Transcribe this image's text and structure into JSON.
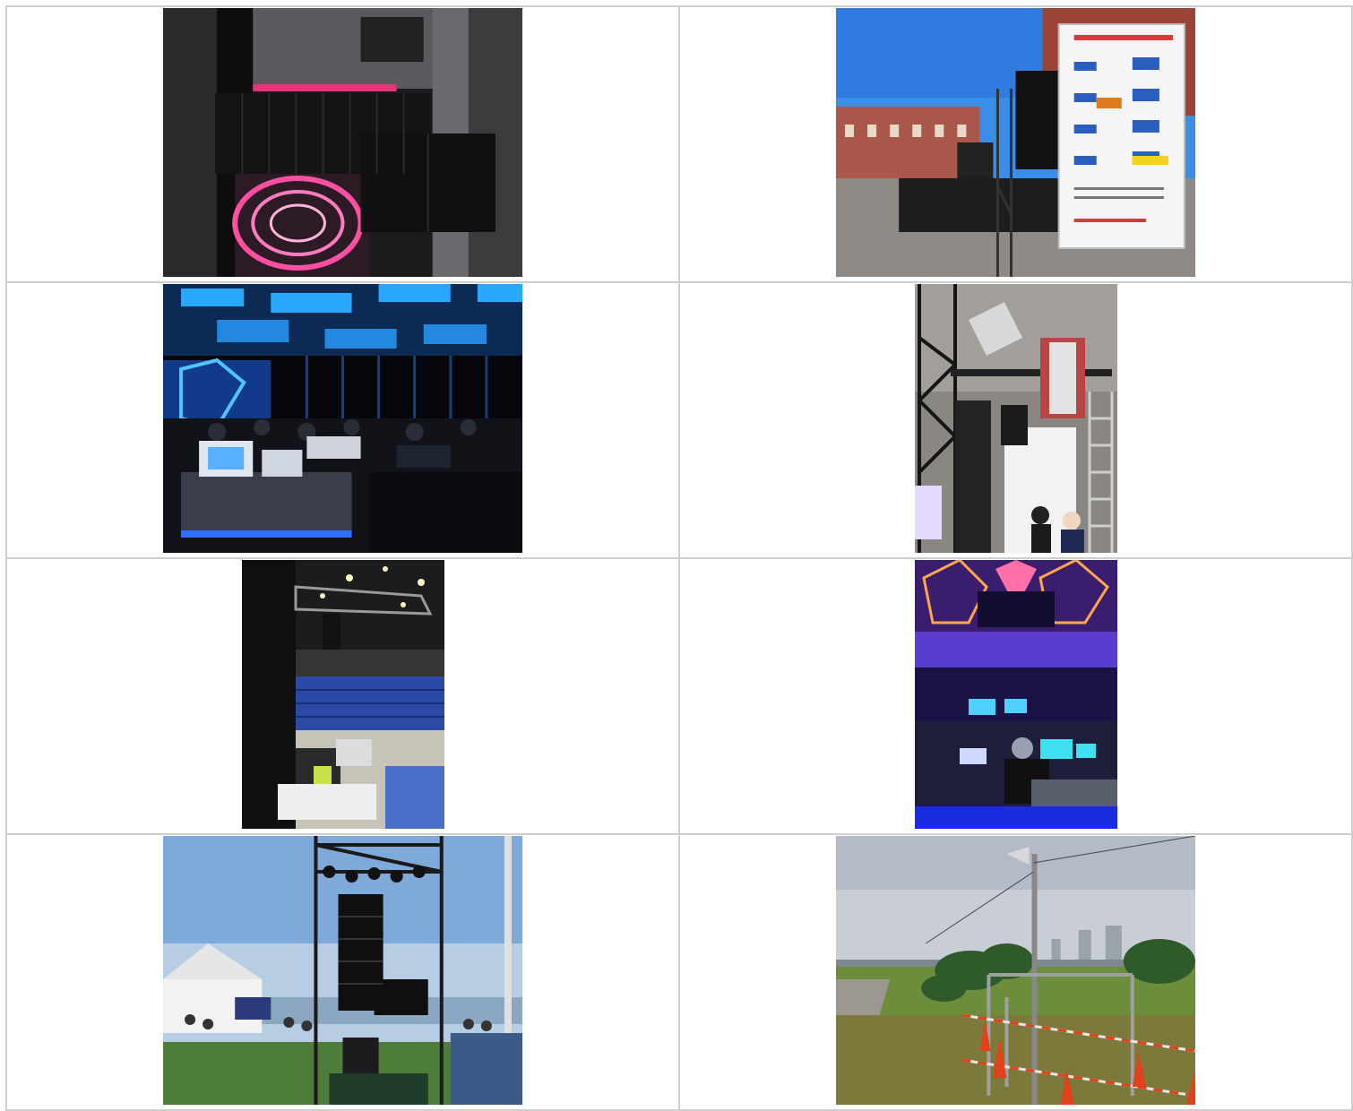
{
  "gallery": {
    "photos": [
      {
        "icon": "line-array-speakers-photo",
        "accent": "#e0367a"
      },
      {
        "icon": "outdoor-stage-banner-photo",
        "accent": "#2f7be0"
      },
      {
        "icon": "conference-hall-mixer-photo",
        "accent": "#2aa8ff"
      },
      {
        "icon": "truss-screen-photo",
        "accent": "#9a9a9a"
      },
      {
        "icon": "arena-rigging-photo",
        "accent": "#2b4aa8"
      },
      {
        "icon": "concert-stage-console-photo",
        "accent": "#7a3bff"
      },
      {
        "icon": "seaside-tower-speakers-photo",
        "accent": "#7fa9d9"
      },
      {
        "icon": "riverside-loudspeaker-photo",
        "accent": "#e2411c"
      }
    ]
  }
}
